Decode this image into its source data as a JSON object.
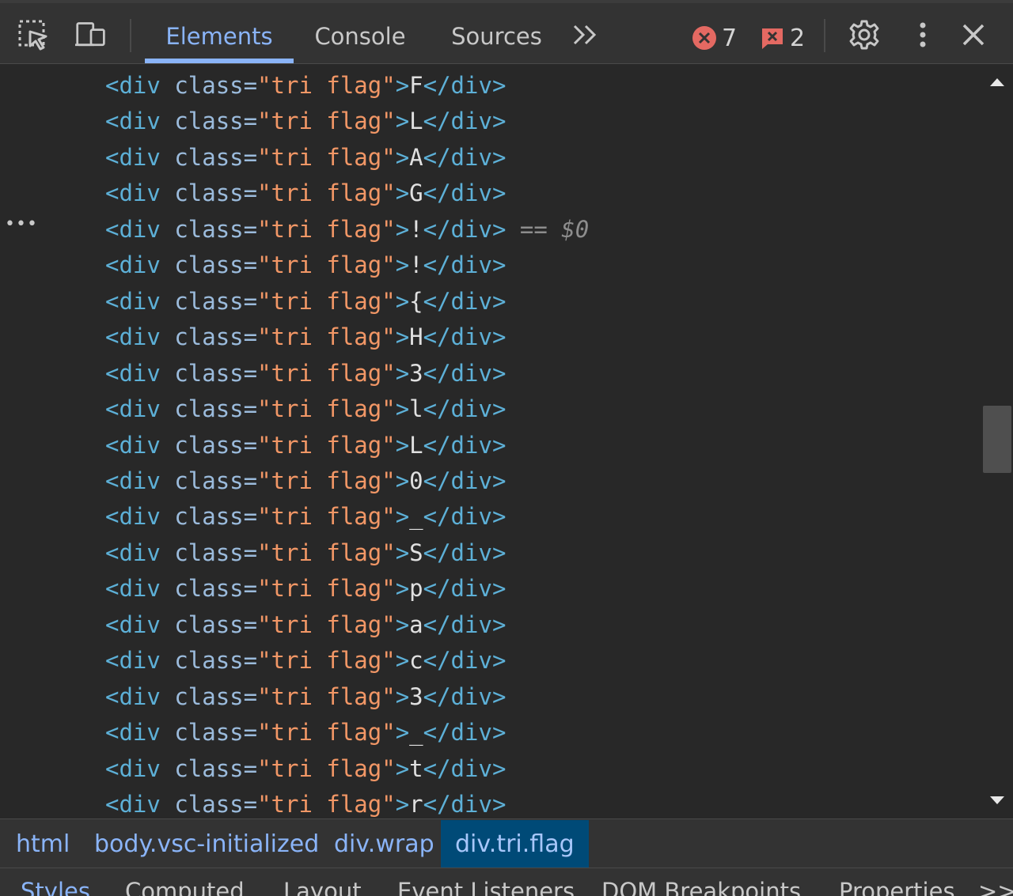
{
  "toolbar": {
    "tabs": [
      {
        "label": "Elements",
        "active": true
      },
      {
        "label": "Console",
        "active": false
      },
      {
        "label": "Sources",
        "active": false
      }
    ],
    "more_tabs_label": ">>",
    "errors": "7",
    "issues": "2"
  },
  "code": {
    "tag_open": "<div",
    "attr_name": "class",
    "attr_value": "\"tri flag\"",
    "tag_close": "</div>",
    "lines": [
      "F",
      "L",
      "A",
      "G",
      "!",
      "!",
      "{",
      "H",
      "3",
      "l",
      "L",
      "0",
      "_",
      "S",
      "p",
      "a",
      "c",
      "3",
      "_",
      "t",
      "r"
    ],
    "selected_index": 4,
    "selected_marker": "== $0",
    "gutter_ellipsis": "•••"
  },
  "breadcrumbs": [
    {
      "label": "html",
      "selected": false
    },
    {
      "label": "body.vsc-initialized",
      "selected": false
    },
    {
      "label": "div.wrap",
      "selected": false
    },
    {
      "label": "div.tri.flag",
      "selected": true
    }
  ],
  "bottom_tabs": [
    {
      "label": "Styles",
      "active": true
    },
    {
      "label": "Computed",
      "active": false
    },
    {
      "label": "Layout",
      "active": false
    },
    {
      "label": "Event Listeners",
      "active": false
    },
    {
      "label": "DOM Breakpoints",
      "active": false
    },
    {
      "label": "Properties",
      "active": false
    }
  ],
  "bottom_more_label": ">>",
  "colors": {
    "accent": "#8ab4f8",
    "error": "#e46962",
    "background": "#282828",
    "tag": "#5db0d7",
    "attr_value": "#f29766"
  },
  "icons": [
    "inspect-element-icon",
    "device-toolbar-icon",
    "chevron-double-right-icon",
    "error-circle-icon",
    "issue-flag-icon",
    "gear-icon",
    "kebab-menu-icon",
    "close-icon"
  ]
}
